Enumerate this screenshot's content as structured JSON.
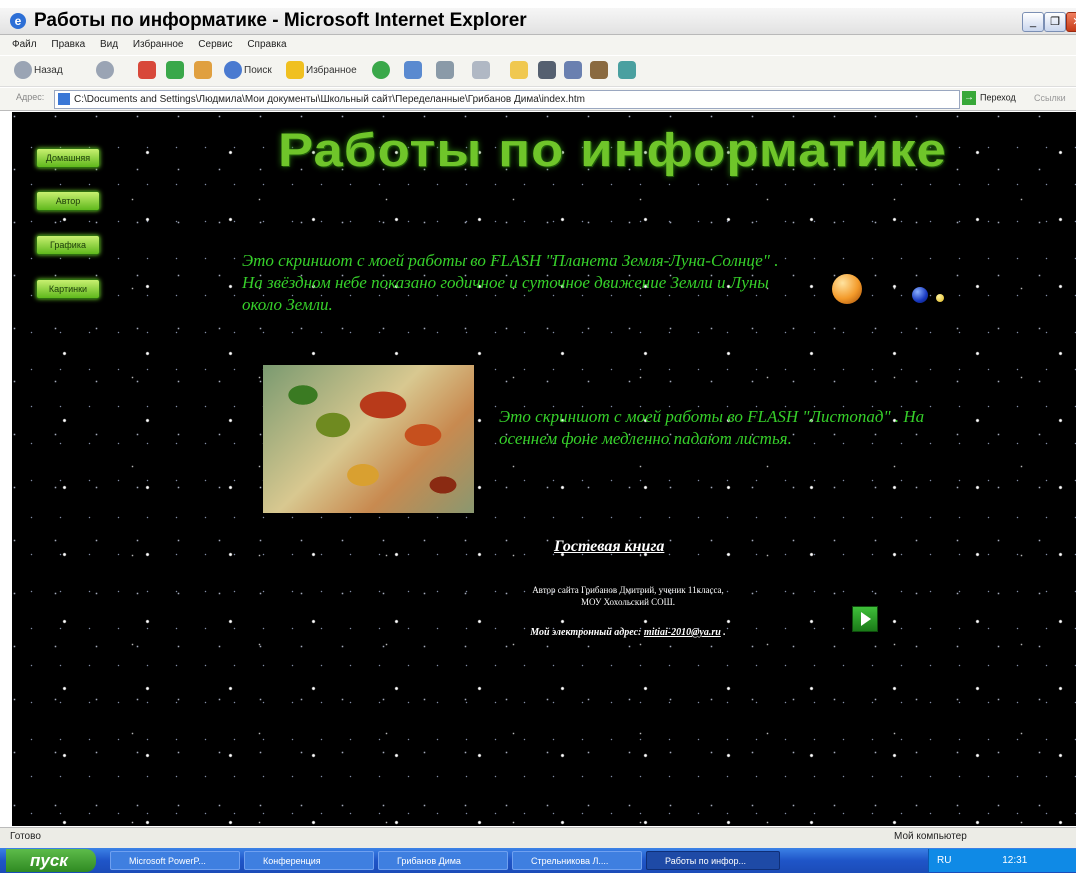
{
  "window": {
    "title": "Работы по информатике - Microsoft Internet Explorer"
  },
  "menu": {
    "items": [
      "Файл",
      "Правка",
      "Вид",
      "Избранное",
      "Сервис",
      "Справка"
    ]
  },
  "toolbar": {
    "back": "Назад",
    "search": "Поиск",
    "favorites": "Избранное"
  },
  "address": {
    "label": "Адрес:",
    "url": "C:\\Documents and Settings\\Людмила\\Мои документы\\Школьный сайт\\Переделанные\\Грибанов Дима\\index.htm",
    "go": "Переход",
    "links": "Ссылки"
  },
  "page": {
    "nav": [
      "Домашняя",
      "Автор",
      "Графика",
      "Картинки"
    ],
    "heading": "Работы по информатике",
    "para1": "Это скриншот с моей работы во FLASH \"Планета Земля-Луна-Солнце\" . На звёздном небе показано годичное и суточное движение Земли и Луны около Земли.",
    "para2": "Это скриншот с моей работы во FLASH \"Листопад\" . На осеннем фоне медленно падают листья.",
    "guestbook": "Гостевая книга",
    "author_line1": "Автор сайта Грибанов Дмитрий, ученик 11класса,",
    "author_line2": "МОУ Хохольский СОШ.",
    "email_label": "Мой электронный адрес:",
    "email": "mitiai-2010@ya.ru",
    "email_tail": "."
  },
  "status": {
    "left": "Готово",
    "right": "Мой компьютер"
  },
  "taskbar": {
    "start": "пуск",
    "tasks": [
      "Microsoft PowerP...",
      "Конференция",
      "Грибанов Дима",
      "Стрельникова Л....",
      "Работы по инфор..."
    ],
    "lang": "RU",
    "clock": "12:31"
  }
}
